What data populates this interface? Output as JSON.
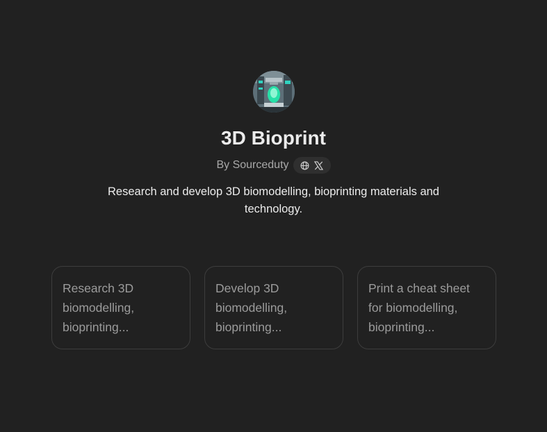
{
  "gpt": {
    "title": "3D Bioprint",
    "byline": "By Sourceduty",
    "description": "Research and develop 3D biomodelling, bioprinting materials and technology."
  },
  "social": {
    "icons": [
      "globe-icon",
      "x-logo-icon"
    ]
  },
  "conversation_starters": [
    {
      "label": "Research 3D biomodelling, bioprinting..."
    },
    {
      "label": "Develop 3D biomodelling, bioprinting..."
    },
    {
      "label": "Print a cheat sheet for biomodelling, bioprinting..."
    }
  ],
  "colors": {
    "background": "#212121",
    "title": "#ececec",
    "muted_text": "#a9a9a9",
    "card_border": "#3d3d3d",
    "card_text": "#9b9b9b",
    "pill_background": "#2f2f2f"
  }
}
